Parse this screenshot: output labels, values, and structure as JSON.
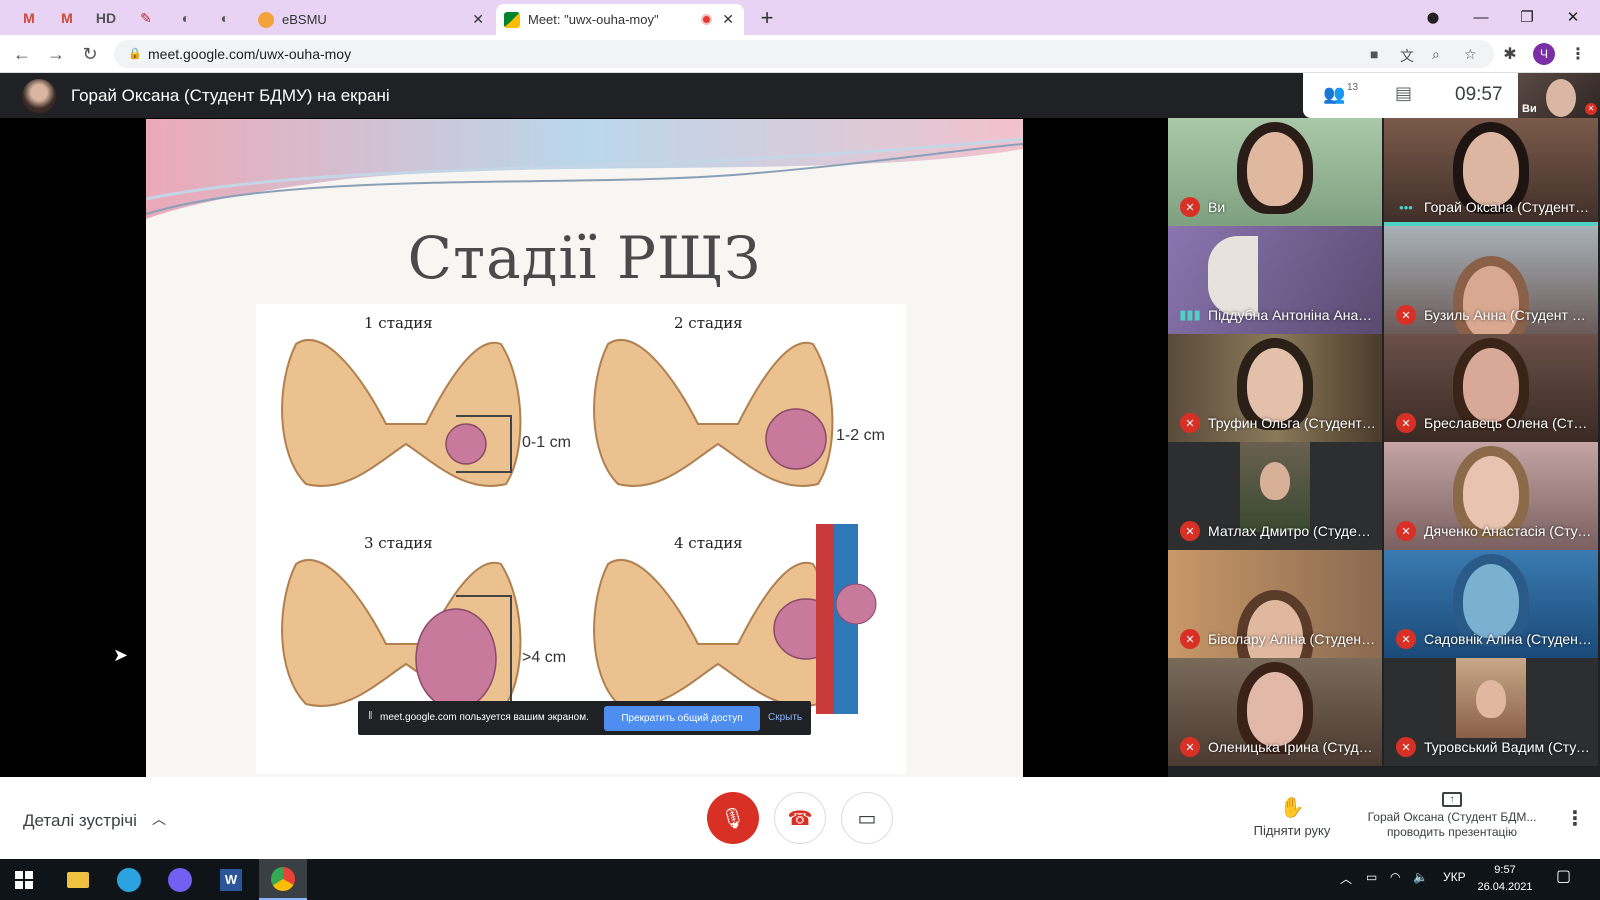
{
  "browser": {
    "pinned_tabs": [
      "M",
      "M",
      "HD",
      "✎",
      "◐",
      "◐"
    ],
    "tabs": [
      {
        "title": "eBSMU",
        "active": false
      },
      {
        "title": "Meet: \"uwx-ouha-moy\"",
        "active": true
      }
    ],
    "new_tab": "+",
    "url": "meet.google.com/uwx-ouha-moy",
    "profile_initial": "Ч"
  },
  "meet": {
    "presenter_title": "Горай Оксана (Студент БДМУ) на екрані",
    "participant_count": "13",
    "time": "09:57",
    "self_label": "Ви",
    "slide": {
      "title": "Стадії РЩЗ",
      "stages": [
        "1 стадия",
        "2 стадия",
        "3 стадия",
        "4 стадия"
      ],
      "sizes": [
        "0-1 cm",
        "1-2 cm",
        ">4 cm"
      ]
    },
    "share_bar": {
      "text": "meet.google.com пользуется вашим экраном.",
      "stop_label": "Прекратить общий доступ",
      "hide_label": "Скрыть"
    },
    "participants": [
      {
        "name": "Ви",
        "muted": true
      },
      {
        "name": "Горай Оксана (Студент Б...",
        "muted": false,
        "presenting": true
      },
      {
        "name": "Піддубна Антоніна Анато...",
        "muted": false,
        "speaking": true
      },
      {
        "name": "Бузиль Анна (Студент БД...",
        "muted": true
      },
      {
        "name": "Труфин Ольга (Студент Б...",
        "muted": true
      },
      {
        "name": "Бреславець Олена (Студе...",
        "muted": true
      },
      {
        "name": "Матлах Дмитро (Студент ...",
        "muted": true
      },
      {
        "name": "Дяченко Анастасія (Студ...",
        "muted": true
      },
      {
        "name": "Біволару Аліна (Студент ...",
        "muted": true
      },
      {
        "name": "Садовнік Аліна (Студент ...",
        "muted": true
      },
      {
        "name": "Оленицька Ірина (Студен...",
        "muted": true
      },
      {
        "name": "Туровський Вадим (Студ...",
        "muted": true
      }
    ],
    "controls": {
      "details_label": "Деталі зустрічі",
      "raise_hand_label": "Підняти руку",
      "presenting_line1": "Горай Оксана (Студент БДМ...",
      "presenting_line2": "проводить презентацію"
    }
  },
  "taskbar": {
    "language": "УКР",
    "time": "9:57",
    "date": "26.04.2021"
  },
  "colors": {
    "tab_strip": "#e8d3f5",
    "meet_dark": "#202124",
    "mute_red": "#d93025",
    "accent_teal": "#4fd1c5",
    "share_blue": "#4d8ef0"
  }
}
